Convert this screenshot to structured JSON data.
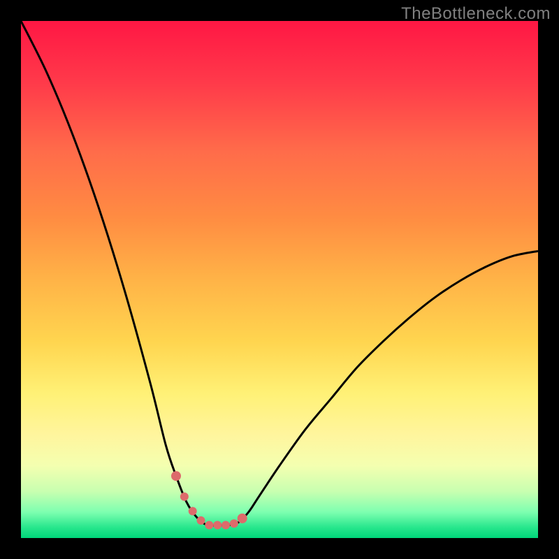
{
  "watermark": "TheBottleneck.com",
  "chart_data": {
    "type": "line",
    "title": "",
    "xlabel": "",
    "ylabel": "",
    "xlim": [
      0,
      100
    ],
    "ylim": [
      0,
      100
    ],
    "series": [
      {
        "name": "bottleneck-curve",
        "description": "V-shaped bottleneck curve descending from top-left, reaching minimum around x=35-42, then rising to right edge at ~55% height",
        "x": [
          0,
          5,
          10,
          15,
          20,
          25,
          28,
          30,
          32,
          34,
          36,
          38,
          40,
          42,
          44,
          46,
          50,
          55,
          60,
          65,
          70,
          75,
          80,
          85,
          90,
          95,
          100
        ],
        "y": [
          100,
          90,
          78,
          64,
          48,
          30,
          18,
          12,
          7,
          4,
          2.5,
          2.5,
          2.5,
          3,
          5,
          8,
          14,
          21,
          27,
          33,
          38,
          42.5,
          46.5,
          49.8,
          52.5,
          54.5,
          55.5
        ]
      }
    ],
    "markers": {
      "description": "Highlighted pink dotted segment at curve minimum",
      "x_range": [
        30,
        44
      ],
      "color": "#dd6b6b"
    },
    "gradient_stops": [
      {
        "offset": 0,
        "color": "#ff1744"
      },
      {
        "offset": 12,
        "color": "#ff3a4a"
      },
      {
        "offset": 25,
        "color": "#ff6b4a"
      },
      {
        "offset": 38,
        "color": "#ff8c42"
      },
      {
        "offset": 50,
        "color": "#ffb347"
      },
      {
        "offset": 62,
        "color": "#ffd54f"
      },
      {
        "offset": 72,
        "color": "#fff176"
      },
      {
        "offset": 80,
        "color": "#fff59d"
      },
      {
        "offset": 86,
        "color": "#f4ffb0"
      },
      {
        "offset": 91,
        "color": "#c8ffb0"
      },
      {
        "offset": 95,
        "color": "#7dffb0"
      },
      {
        "offset": 98,
        "color": "#26e68c"
      },
      {
        "offset": 100,
        "color": "#00d67a"
      }
    ]
  }
}
